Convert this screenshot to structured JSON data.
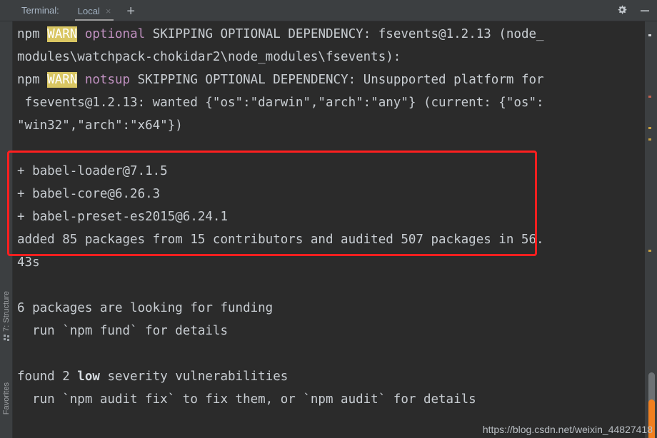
{
  "window": {
    "tabbar": {
      "terminal_label": "Terminal:",
      "active_tab": "Local",
      "close_glyph": "×",
      "add_glyph": "+",
      "settings_icon": "gear-icon",
      "minimize_icon": "minimize-icon"
    },
    "left_rail": {
      "structure_label": "7: Structure",
      "favorites_label": "Favorites"
    },
    "scrollbar": {
      "thumb_color": "#6e7275",
      "highlight_color": "#f08020"
    },
    "watermark": "https://blog.csdn.net/weixin_44827418"
  },
  "annotation": {
    "highlight_color": "#ff1f1f",
    "shape": "rectangle"
  },
  "terminal": {
    "background": "#2b2b2b",
    "foreground": "#c8cdd2",
    "warn_badge_bg": "#d9c662",
    "warn_badge_fg": "#ffffff",
    "keyword_color": "#c191c1",
    "lines": [
      {
        "id": "l1",
        "segments": [
          {
            "text": "npm ",
            "style": "plain"
          },
          {
            "text": "WARN",
            "style": "warn"
          },
          {
            "text": " ",
            "style": "plain"
          },
          {
            "text": "optional",
            "style": "magenta"
          },
          {
            "text": " SKIPPING OPTIONAL DEPENDENCY: fsevents@1.2.13 (node_",
            "style": "plain"
          }
        ]
      },
      {
        "id": "l2",
        "segments": [
          {
            "text": "modules\\watchpack-chokidar2\\node_modules\\fsevents):",
            "style": "plain"
          }
        ]
      },
      {
        "id": "l3",
        "segments": [
          {
            "text": "npm ",
            "style": "plain"
          },
          {
            "text": "WARN",
            "style": "warn"
          },
          {
            "text": " ",
            "style": "plain"
          },
          {
            "text": "notsup",
            "style": "magenta"
          },
          {
            "text": " SKIPPING OPTIONAL DEPENDENCY: Unsupported platform for",
            "style": "plain"
          }
        ]
      },
      {
        "id": "l4",
        "segments": [
          {
            "text": " fsevents@1.2.13: wanted {\"os\":\"darwin\",\"arch\":\"any\"} (current: {\"os\":",
            "style": "plain"
          }
        ]
      },
      {
        "id": "l5",
        "segments": [
          {
            "text": "\"win32\",\"arch\":\"x64\"})",
            "style": "plain"
          }
        ]
      },
      {
        "id": "l6",
        "segments": [
          {
            "text": "",
            "style": "plain"
          }
        ]
      },
      {
        "id": "l7",
        "segments": [
          {
            "text": "+ babel-loader@7.1.5",
            "style": "plain"
          }
        ]
      },
      {
        "id": "l8",
        "segments": [
          {
            "text": "+ babel-core@6.26.3",
            "style": "plain"
          }
        ]
      },
      {
        "id": "l9",
        "segments": [
          {
            "text": "+ babel-preset-es2015@6.24.1",
            "style": "plain"
          }
        ]
      },
      {
        "id": "l10",
        "segments": [
          {
            "text": "added 85 packages from 15 contributors and audited 507 packages in 56.",
            "style": "plain"
          }
        ]
      },
      {
        "id": "l11",
        "segments": [
          {
            "text": "43s",
            "style": "plain"
          }
        ]
      },
      {
        "id": "l12",
        "segments": [
          {
            "text": "",
            "style": "plain"
          }
        ]
      },
      {
        "id": "l13",
        "segments": [
          {
            "text": "6 packages are looking for funding",
            "style": "plain"
          }
        ]
      },
      {
        "id": "l14",
        "segments": [
          {
            "text": "  run `npm fund` for details",
            "style": "plain"
          }
        ]
      },
      {
        "id": "l15",
        "segments": [
          {
            "text": "",
            "style": "plain"
          }
        ]
      },
      {
        "id": "l16",
        "segments": [
          {
            "text": "found 2 ",
            "style": "plain"
          },
          {
            "text": "low",
            "style": "bold"
          },
          {
            "text": " severity vulnerabilities",
            "style": "plain"
          }
        ]
      },
      {
        "id": "l17",
        "segments": [
          {
            "text": "  run `npm audit fix` to fix them, or `npm audit` for details",
            "style": "plain"
          }
        ]
      }
    ]
  }
}
